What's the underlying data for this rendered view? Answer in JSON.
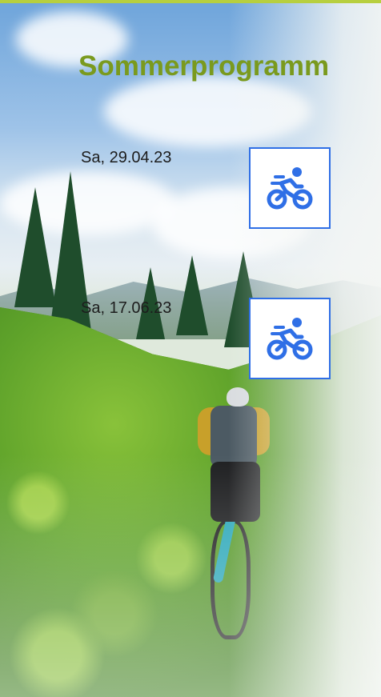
{
  "page": {
    "title": "Sommerprogramm",
    "accent_color": "#7a9a1e",
    "border_color": "#2f6fe6"
  },
  "events": [
    {
      "date": "Sa, 29.04.23",
      "icon": "mountain-bike-icon"
    },
    {
      "date": "Sa, 17.06.23",
      "icon": "mountain-bike-icon"
    }
  ]
}
